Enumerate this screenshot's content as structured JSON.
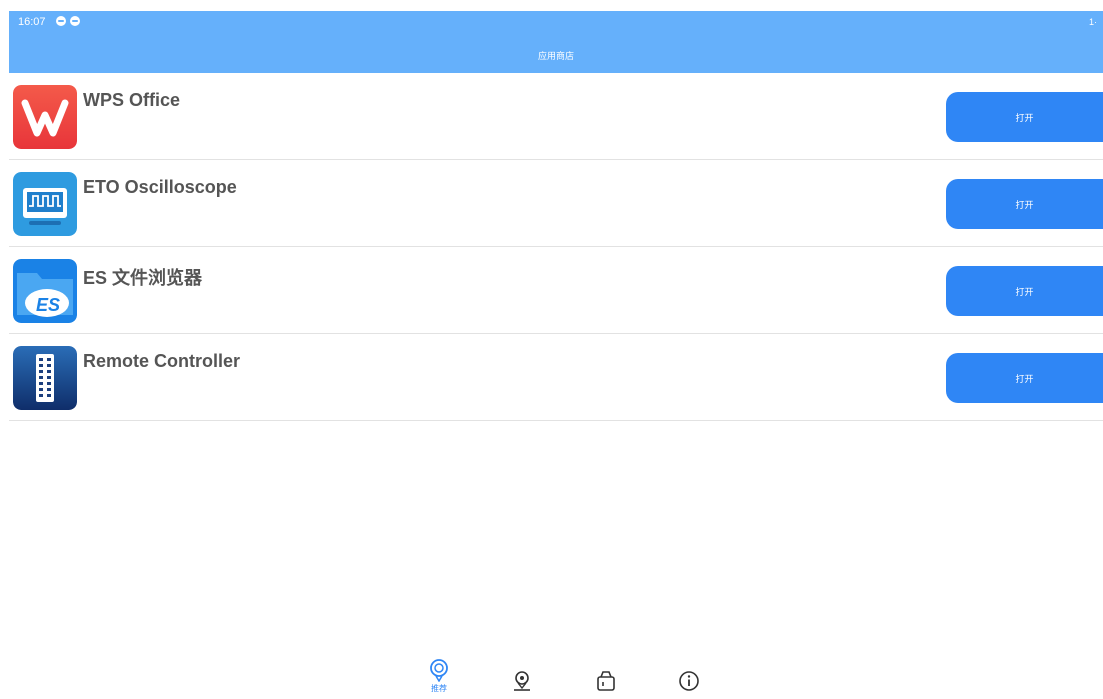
{
  "status_bar": {
    "time": "16:07",
    "right_text": "1·"
  },
  "header": {
    "title": "应用商店"
  },
  "apps": [
    {
      "name": "WPS Office",
      "button_label": "打开",
      "icon": "wps-office-icon"
    },
    {
      "name": "ETO  Oscilloscope",
      "button_label": "打开",
      "icon": "oscilloscope-icon"
    },
    {
      "name": "ES 文件浏览器",
      "button_label": "打开",
      "icon": "es-file-explorer-icon"
    },
    {
      "name": "Remote Controller",
      "button_label": "打开",
      "icon": "remote-controller-icon"
    }
  ],
  "tabs": [
    {
      "label": "推荐",
      "icon": "recommend-icon",
      "active": true
    },
    {
      "label": "",
      "icon": "location-icon",
      "active": false
    },
    {
      "label": "",
      "icon": "package-icon",
      "active": false
    },
    {
      "label": "",
      "icon": "info-icon",
      "active": false
    }
  ],
  "colors": {
    "header": "#65b0fb",
    "button": "#2f86f5",
    "tab_active": "#2f86f5",
    "tab_inactive": "#333333"
  }
}
